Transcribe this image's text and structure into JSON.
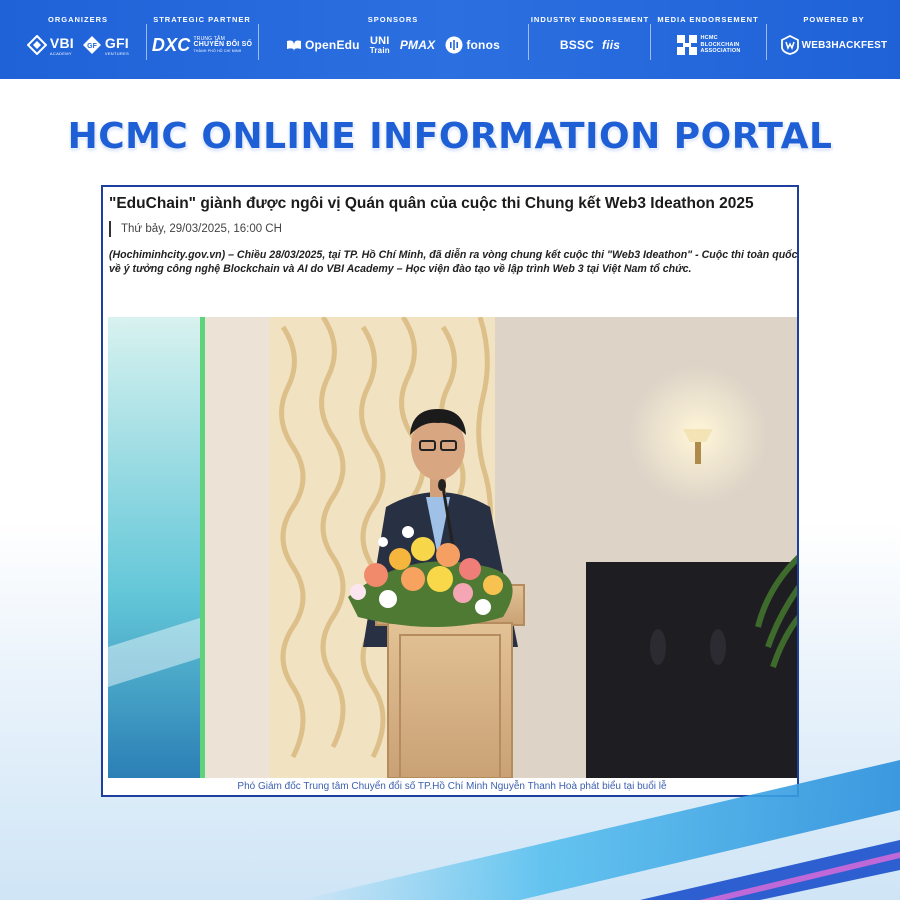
{
  "banner": {
    "organizers": {
      "title": "ORGANIZERS",
      "logos": [
        "VBI",
        "ACADEMY",
        "GFI",
        "VENTURES"
      ]
    },
    "strategic_partner": {
      "title": "STRATEGIC PARTNER",
      "logos": [
        "DXC",
        "TRUNG TÂM",
        "CHUYỂN ĐỔI SỐ",
        "THÀNH PHỐ HỒ CHÍ MINH"
      ]
    },
    "sponsors": {
      "title": "SPONSORS",
      "logos": [
        "OpenEdu",
        "UNI",
        "Train",
        "PMAX",
        "fonos"
      ]
    },
    "industry_endorsement": {
      "title": "INDUSTRY ENDORSEMENT",
      "logos": [
        "BSSC",
        "fiis"
      ]
    },
    "media_endorsement": {
      "title": "MEDIA ENDORSEMENT",
      "logos": [
        "HCMC",
        "BLOCKCHAIN",
        "ASSOCIATION"
      ]
    },
    "powered_by": {
      "title": "POWERED BY",
      "logos": [
        "WEB3HACKFEST"
      ]
    }
  },
  "headline": "HCMC ONLINE INFORMATION PORTAL",
  "article": {
    "title": "\"EduChain\" giành được ngôi vị Quán quân của cuộc thi Chung kết Web3 Ideathon 2025",
    "date": "Thứ bảy, 29/03/2025, 16:00 CH",
    "lead": "(Hochiminhcity.gov.vn) – Chiều 28/03/2025, tại TP. Hồ Chí Minh, đã diễn ra vòng chung kết cuộc thi \"Web3 Ideathon\" - Cuộc thi toàn quốc về ý tưởng công nghệ Blockchain và AI do VBI Academy – Học viện đào tạo về lập trình Web 3 tại Việt Nam tổ chức.",
    "caption": "Phó Giám đốc Trung tâm Chuyển đổi số TP.Hồ Chí Minh Nguyễn Thanh Hoà phát biểu tại buổi lễ"
  },
  "colors": {
    "banner_blue": "#2366dc",
    "headline_blue": "#1f5fd6",
    "card_border": "#1d3f9e",
    "caption_blue": "#3b5fb0"
  }
}
